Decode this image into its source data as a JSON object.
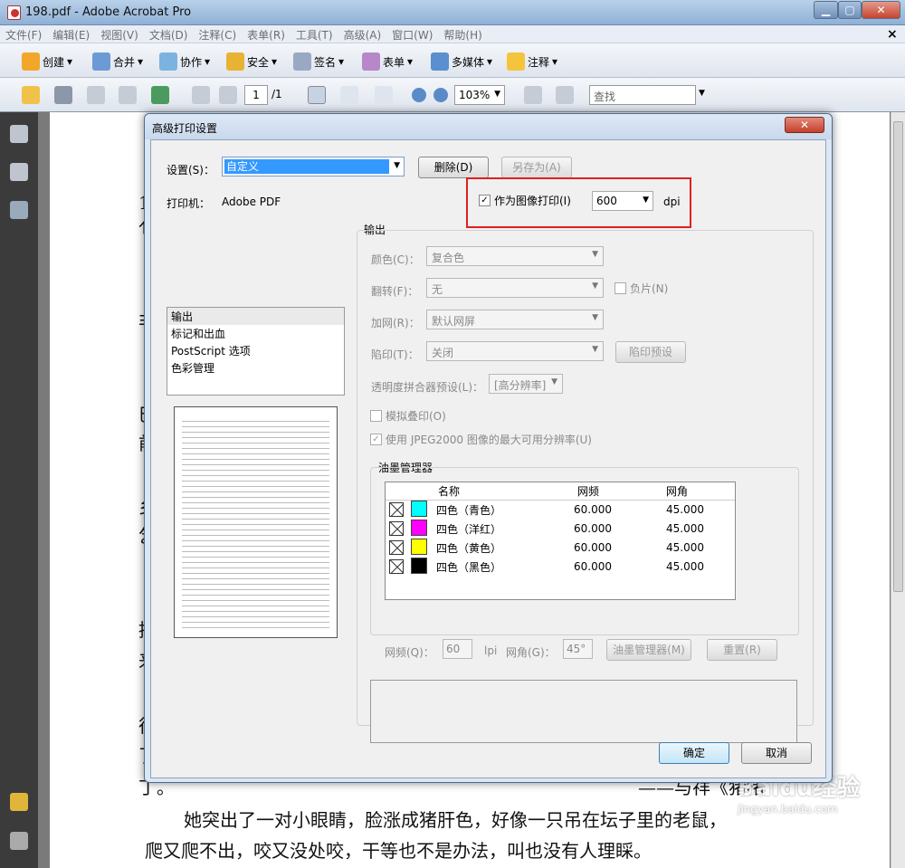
{
  "window": {
    "title": "198.pdf - Adobe Acrobat Pro",
    "close_x": "×"
  },
  "menu": [
    "文件(F)",
    "编辑(E)",
    "视图(V)",
    "文档(D)",
    "注释(C)",
    "表单(R)",
    "工具(T)",
    "高级(A)",
    "窗口(W)",
    "帮助(H)"
  ],
  "toolbar1": [
    "创建",
    "合并",
    "协作",
    "安全",
    "签名",
    "表单",
    "多媒体",
    "注释"
  ],
  "toolbar2": {
    "page_current": "1",
    "page_total": "/1",
    "zoom": "103%",
    "find_placeholder": "查找"
  },
  "doc": {
    "line1": "她突出了一对小眼睛，脸涨成猪肝色，好像一只吊在坛子里的老鼠，",
    "line2": "爬又爬不出，咬又没处咬，干等也不是办法，叫也没有人理睬。",
    "line0": "——与祥《猪猪",
    "left_chars": [
      "1",
      "亻",
      "非",
      "巳",
      "前",
      "乡",
      "乞",
      "推",
      "来",
      "往",
      "了",
      "丁。"
    ]
  },
  "watermark": {
    "logo": "Baidu经验",
    "url": "jingyan.baidu.com"
  },
  "dialog": {
    "title": "高级打印设置",
    "settings_label": "设置(S)：",
    "settings_value": "自定义",
    "delete_button": "删除(D)",
    "saveas_button": "另存为(A)",
    "printer_label": "打印机：",
    "printer_value": "Adobe PDF",
    "print_as_image_label": "作为图像打印(I)",
    "print_as_image_checked": true,
    "dpi_value": "600",
    "dpi_unit": "dpi",
    "nav_items": [
      "输出",
      "标记和出血",
      "PostScript 选项",
      "色彩管理"
    ],
    "output": {
      "title": "输出",
      "color_label": "颜色(C)：",
      "color_value": "复合色",
      "flip_label": "翻转(F)：",
      "flip_value": "无",
      "negative_label": "负片(N)",
      "screen_label": "加网(R)：",
      "screen_value": "默认网屏",
      "trap_label": "陷印(T)：",
      "trap_value": "关闭",
      "trap_preset_button": "陷印预设",
      "flattener_label": "透明度拼合器预设(L)：",
      "flattener_value": "[高分辨率]",
      "simulate_label": "模拟叠印(O)",
      "jpeg2000_label": "使用 JPEG2000 图像的最大可用分辨率(U)",
      "ink_manager_title": "油墨管理器",
      "ink_headers": [
        "名称",
        "网频",
        "网角"
      ],
      "inks": [
        {
          "name": "四色（青色）",
          "freq": "60.000",
          "angle": "45.000",
          "color": "#00ffff"
        },
        {
          "name": "四色（洋红）",
          "freq": "60.000",
          "angle": "45.000",
          "color": "#ff00ff"
        },
        {
          "name": "四色（黄色）",
          "freq": "60.000",
          "angle": "45.000",
          "color": "#ffff00"
        },
        {
          "name": "四色（黑色）",
          "freq": "60.000",
          "angle": "45.000",
          "color": "#000000"
        }
      ],
      "freq_label": "网频(Q)：",
      "freq_value": "60",
      "freq_unit": "lpi",
      "angle_label": "网角(G)：",
      "angle_value": "45°",
      "ink_manager_button": "油墨管理器(M)",
      "reset_button": "重置(R)"
    },
    "ok_button": "确定",
    "cancel_button": "取消"
  }
}
